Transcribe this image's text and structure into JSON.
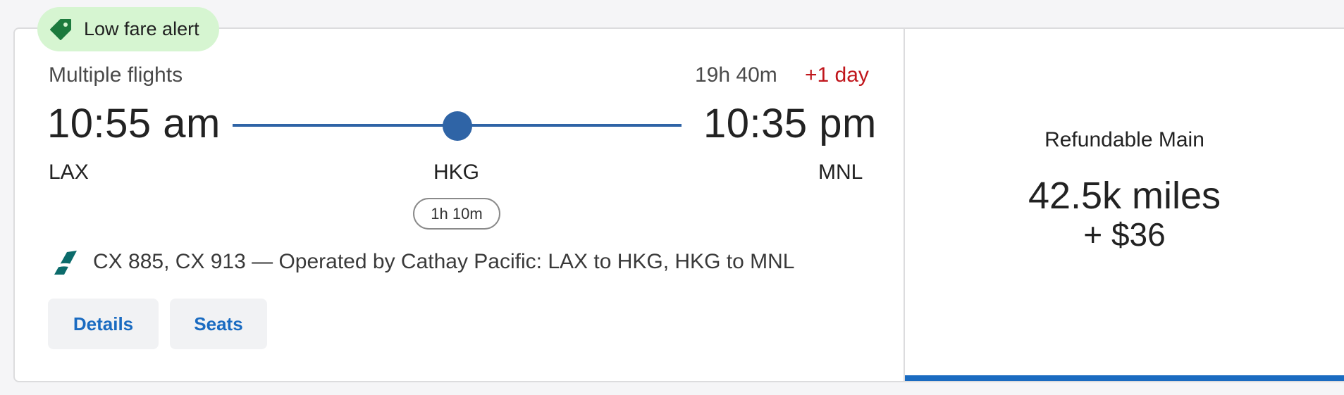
{
  "badge": {
    "label": "Low fare alert",
    "icon": "price-tag-icon",
    "color": "#d6f5d1"
  },
  "itinerary": {
    "type_label": "Multiple flights",
    "total_duration": "19h 40m",
    "day_offset": "+1 day",
    "departure_time": "10:55 am",
    "arrival_time": "10:35 pm",
    "origin": "LAX",
    "stop": "HKG",
    "destination": "MNL",
    "layover_duration": "1h 10m",
    "flight_info": "CX 885, CX 913 — Operated by Cathay Pacific: LAX to HKG, HKG to MNL",
    "carrier_icon": "cathay-pacific-logo-icon",
    "route_color": "#2f64a6"
  },
  "actions": {
    "details_label": "Details",
    "seats_label": "Seats"
  },
  "fare": {
    "name": "Refundable Main",
    "miles": "42.5k miles",
    "cash": "+ $36",
    "selected_color": "#1a6bc1"
  }
}
